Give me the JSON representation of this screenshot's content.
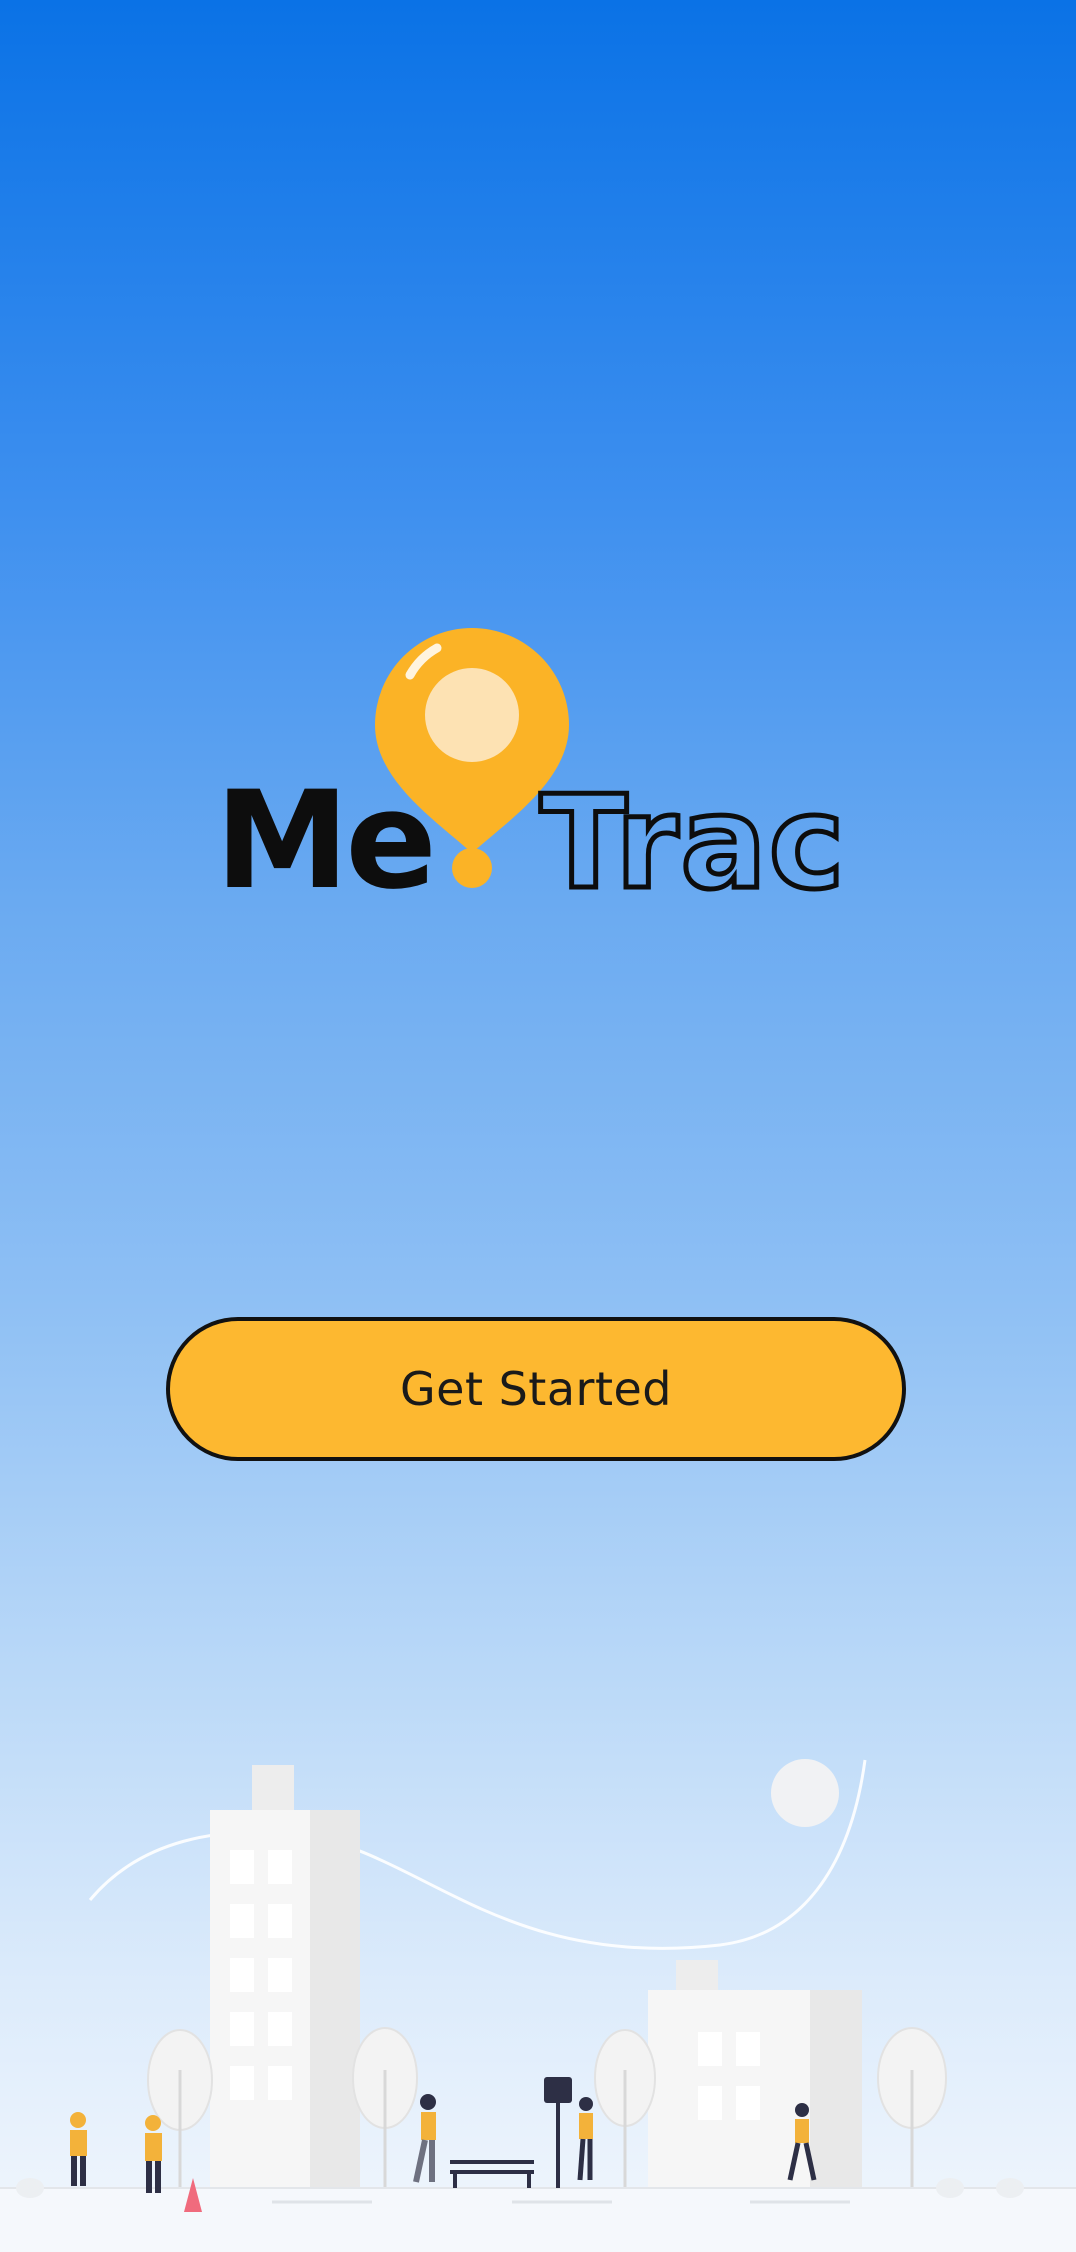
{
  "logo": {
    "text_left": "Me",
    "text_right": "Trac",
    "icon": "location-pin-icon",
    "accent_color": "#fdb830"
  },
  "actions": {
    "get_started_label": "Get Started"
  },
  "colors": {
    "background_top": "#0a72e6",
    "background_bottom": "#f2f7fd",
    "button": "#fdb830"
  },
  "illustration": {
    "name": "city-street-illustration"
  }
}
